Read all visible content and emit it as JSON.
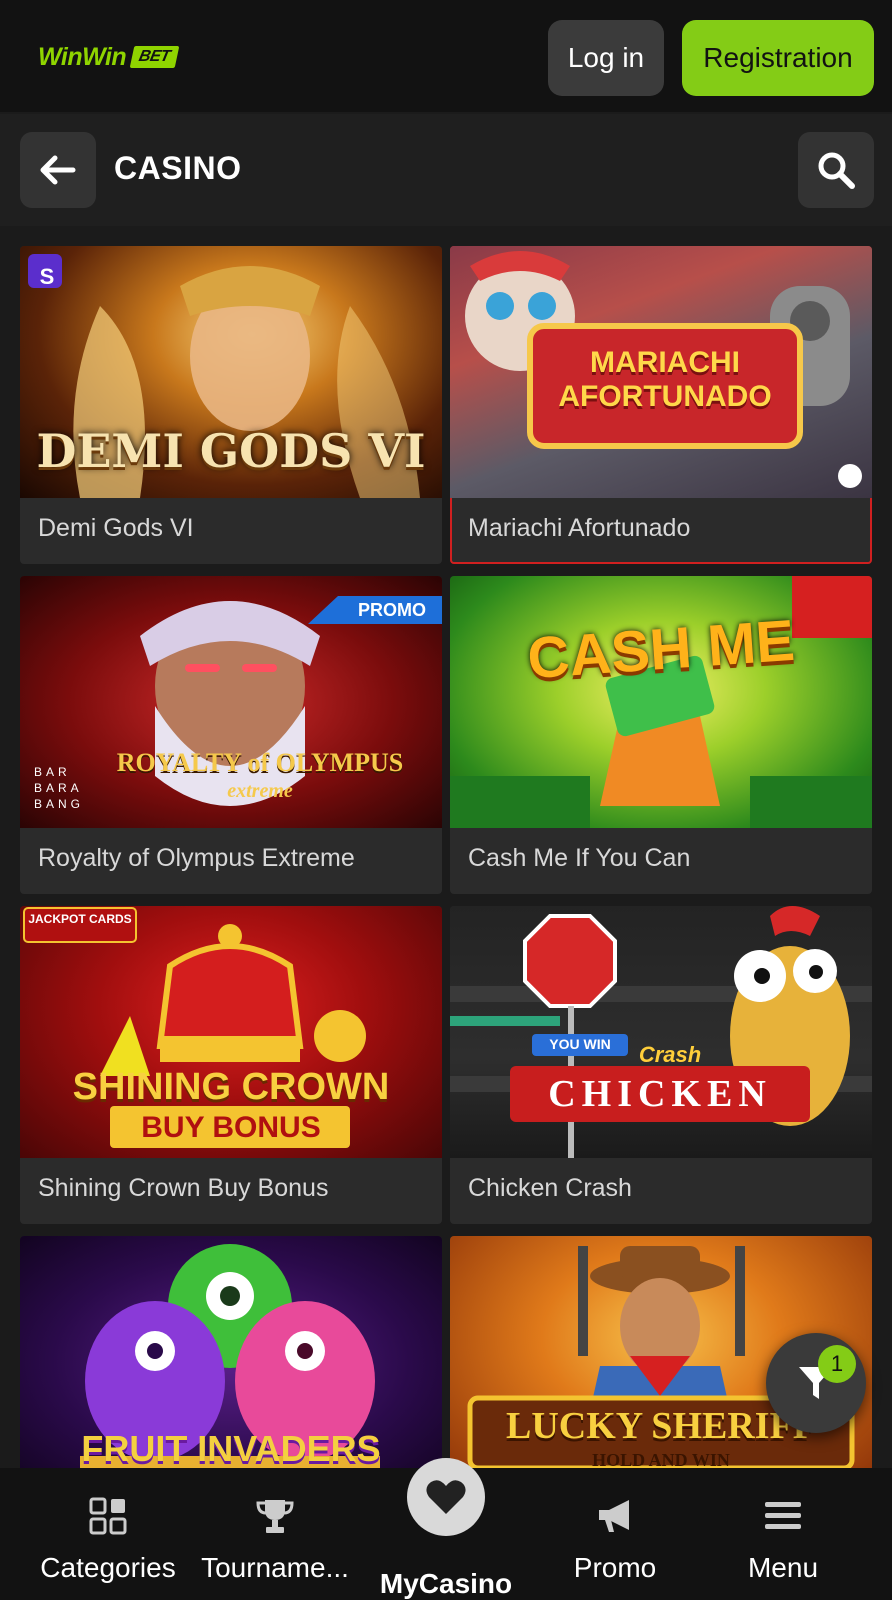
{
  "header": {
    "logo_text": "WinWin",
    "logo_badge": "BET",
    "login_label": "Log in",
    "register_label": "Registration"
  },
  "section": {
    "title": "CASINO"
  },
  "games": [
    {
      "title": "Demi Gods VI",
      "art_text": "DEMI GODS VI",
      "provider_badge": "S"
    },
    {
      "title": "Mariachi Afortunado",
      "art_text": "MARIACHI AFORTUNADO"
    },
    {
      "title": "Royalty of Olympus Extreme",
      "art_text": "ROYALTY of OLYMPUS",
      "art_subtext": "extreme",
      "provider_text": "BAR BARA BANG",
      "badge": "PROMO"
    },
    {
      "title": "Cash Me If You Can",
      "art_text": "CASH ME"
    },
    {
      "title": "Shining Crown Buy Bonus",
      "art_text": "SHINING CROWN",
      "art_subtext": "BUY BONUS",
      "corner_text": "JACKPOT CARDS"
    },
    {
      "title": "Chicken Crash",
      "art_text": "CHICKEN",
      "art_subtext": "Crash",
      "sign_text": "YOU WIN"
    },
    {
      "title": "",
      "art_text": "FRUIT INVADERS"
    },
    {
      "title": "",
      "art_text": "LUCKY SHERIFF",
      "art_subtext": "HOLD AND WIN"
    }
  ],
  "filter": {
    "count": "1"
  },
  "bottom_nav": {
    "items": [
      {
        "label": "Categories",
        "icon": "grid-icon"
      },
      {
        "label": "Tourname...",
        "icon": "trophy-icon"
      },
      {
        "label": "MyCasino",
        "icon": "heart-icon"
      },
      {
        "label": "Promo",
        "icon": "megaphone-icon"
      },
      {
        "label": "Menu",
        "icon": "hamburger-icon"
      }
    ]
  },
  "colors": {
    "accent": "#84cc16",
    "header_bg": "#121212",
    "card_bg": "#2b2b2b",
    "promo_badge": "#1e6fd9"
  }
}
